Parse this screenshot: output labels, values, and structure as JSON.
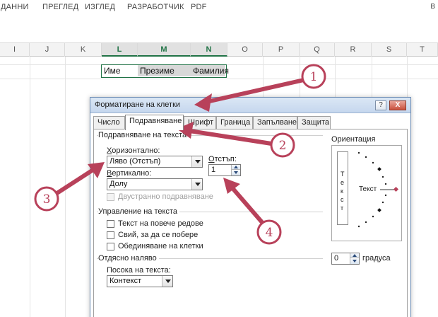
{
  "ribbon": {
    "tabs": [
      "ДАННИ",
      "ПРЕГЛЕД",
      "ИЗГЛЕД",
      "РАЗРАБОТЧИК",
      "PDF"
    ],
    "right_marker": "B"
  },
  "sheet": {
    "columns": [
      "I",
      "J",
      "K",
      "L",
      "M",
      "N",
      "O",
      "P",
      "Q",
      "R",
      "S",
      "T"
    ],
    "cells": [
      "Име",
      "Презиме",
      "Фамилия"
    ]
  },
  "dialog": {
    "title": "Форматиране на клетки",
    "help": "?",
    "close": "X",
    "tabs": [
      "Число",
      "Подравняване",
      "Шрифт",
      "Граница",
      "Запълване",
      "Защита"
    ],
    "text_alignment": {
      "group": "Подравняване на текста",
      "horizontal_label_u": "Х",
      "horizontal_label_rest": "оризонтално:",
      "horizontal_value": "Ляво (Отстъп)",
      "indent_label_u": "О",
      "indent_label_rest": "тстъп:",
      "indent_value": "1",
      "vertical_label_u": "В",
      "vertical_label_rest": "ертикално:",
      "vertical_value": "Долу",
      "justify_distributed": "Двустранно подравняване"
    },
    "text_control": {
      "group": "Управление на текста",
      "wrap": "Текст на повече редове",
      "shrink": "Свий, за да се побере",
      "merge": "Обединяване на клетки"
    },
    "rtl": {
      "group": "Отдясно наляво",
      "direction_label": "Посока на текста:",
      "direction_value": "Контекст"
    },
    "orientation": {
      "group": "Ориентация",
      "vertical_text": [
        "Т",
        "е",
        "к",
        "с",
        "т"
      ],
      "horizontal_text": "Текст",
      "degrees_value": "0",
      "degrees_label": "градуса"
    }
  },
  "annotations": [
    "1",
    "2",
    "3",
    "4"
  ],
  "colors": {
    "annotation": "#b8415a",
    "excel_green": "#217346"
  }
}
